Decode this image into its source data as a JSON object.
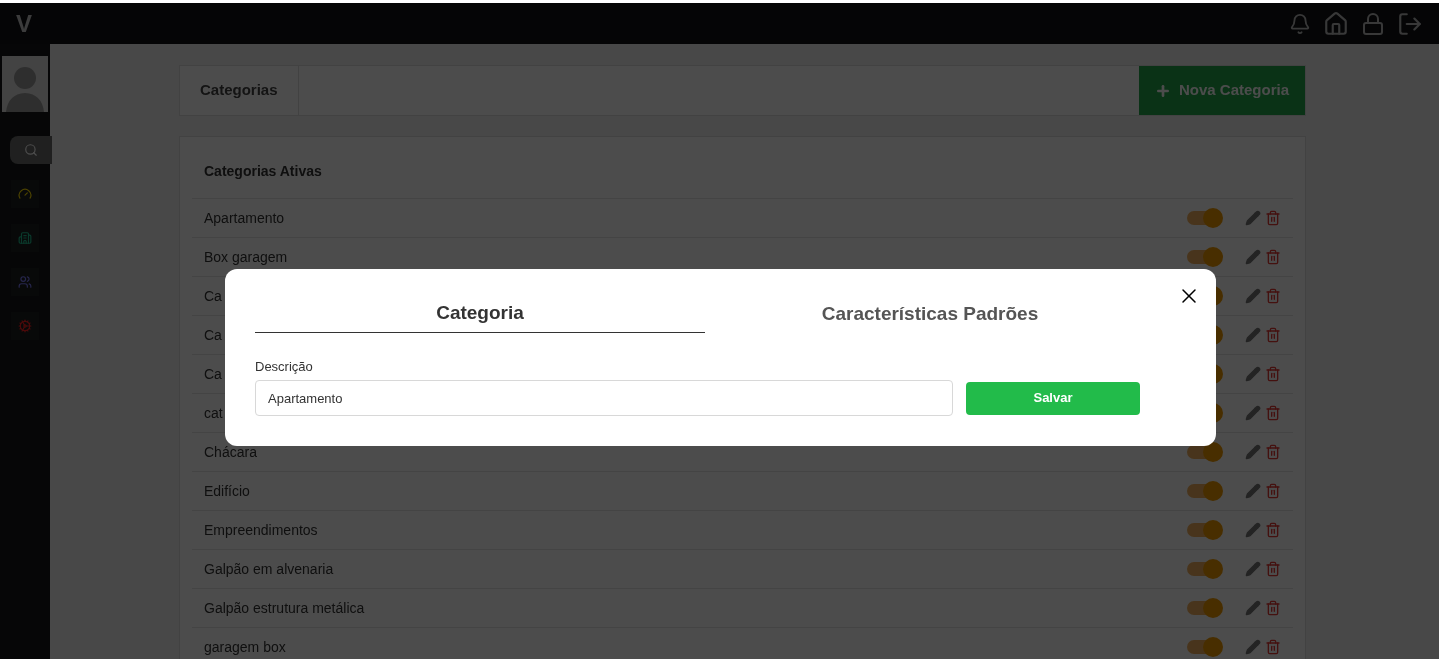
{
  "header": {
    "logo": "V"
  },
  "page": {
    "title": "Categorias",
    "new_button": "Nova Categoria",
    "section_title": "Categorias Ativas",
    "rows": [
      {
        "name": "Apartamento",
        "on": true
      },
      {
        "name": "Box garagem",
        "on": true
      },
      {
        "name": "Ca",
        "on": true
      },
      {
        "name": "Ca",
        "on": true
      },
      {
        "name": "Ca",
        "on": true
      },
      {
        "name": "cat",
        "on": true
      },
      {
        "name": "Chácara",
        "on": true
      },
      {
        "name": "Edifício",
        "on": true
      },
      {
        "name": "Empreendimentos",
        "on": true
      },
      {
        "name": "Galpão em alvenaria",
        "on": true
      },
      {
        "name": "Galpão estrutura metálica",
        "on": true
      },
      {
        "name": "garagem box",
        "on": true
      }
    ]
  },
  "modal": {
    "tabs": [
      {
        "label": "Categoria",
        "selected": true
      },
      {
        "label": "Características Padrões",
        "selected": false
      }
    ],
    "field": {
      "label": "Descrição",
      "value": "Apartamento"
    },
    "save_button": "Salvar"
  }
}
